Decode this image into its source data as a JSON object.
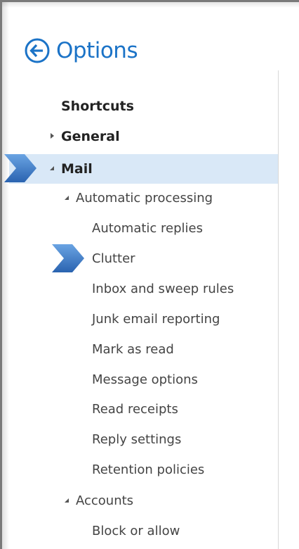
{
  "header": {
    "title": "Options",
    "back_icon": "back-arrow-circle-icon",
    "accent": "#1b73c7"
  },
  "nav": {
    "shortcuts": "Shortcuts",
    "general": "General",
    "mail": "Mail",
    "automatic_processing": "Automatic processing",
    "auto_items": [
      "Automatic replies",
      "Clutter",
      "Inbox and sweep rules",
      "Junk email reporting",
      "Mark as read",
      "Message options",
      "Read receipts",
      "Reply settings",
      "Retention policies"
    ],
    "accounts": "Accounts",
    "accounts_items": [
      "Block or allow"
    ]
  },
  "selection_color": "#d9e8f7",
  "callout_color": "#3a78c2"
}
